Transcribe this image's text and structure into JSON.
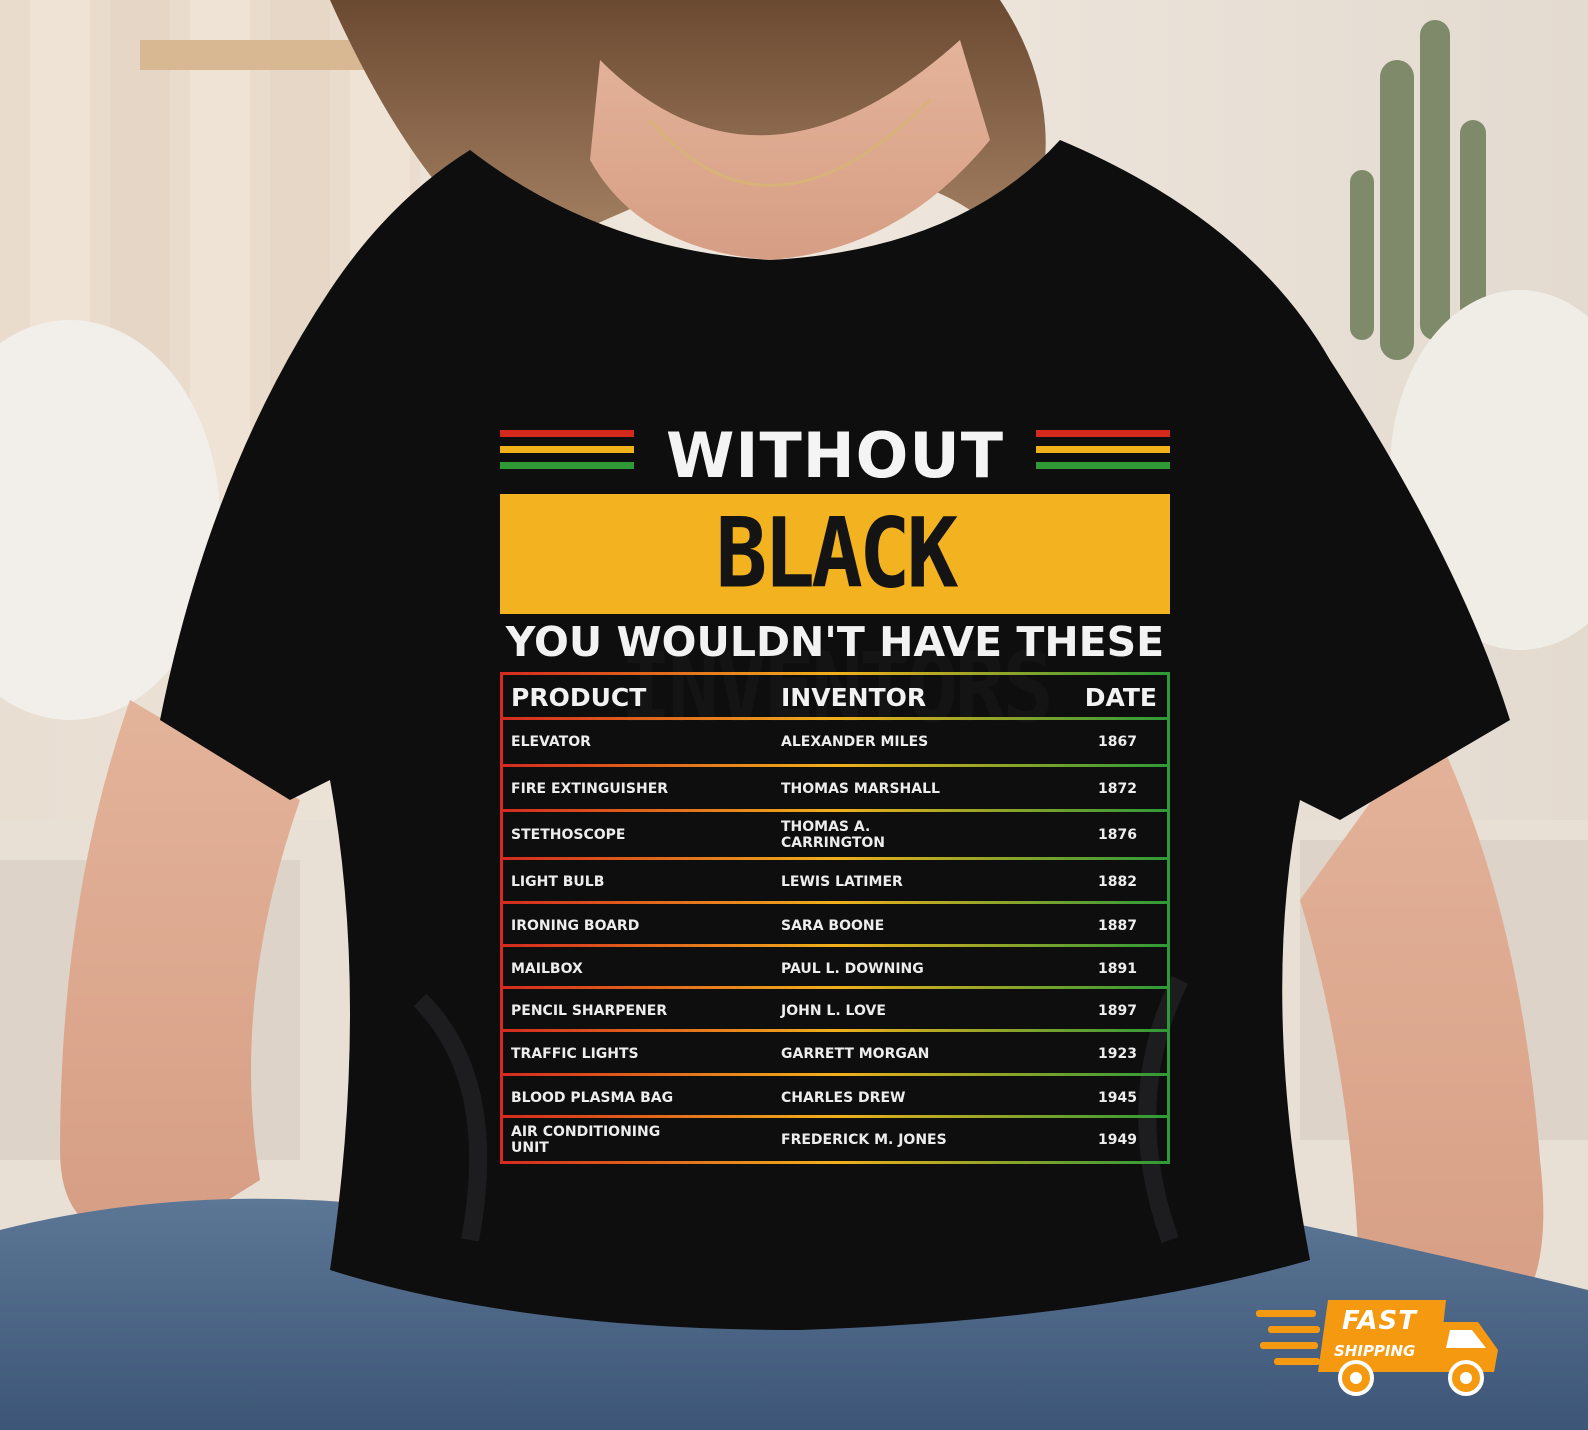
{
  "design": {
    "headline_top": "WITHOUT",
    "headline_main": "BLACK INVENTORS",
    "headline_sub": "YOU WOULDN'T HAVE THESE",
    "stripe_colors": [
      "#d42a1e",
      "#f0b11a",
      "#2f9a35"
    ],
    "band_color": "#f3b320"
  },
  "table": {
    "headers": {
      "product": "PRODUCT",
      "inventor": "INVENTOR",
      "date": "DATE"
    },
    "rows": [
      {
        "product": "ELEVATOR",
        "inventor": "ALEXANDER MILES",
        "date": "1867"
      },
      {
        "product": "FIRE EXTINGUISHER",
        "inventor": "THOMAS MARSHALL",
        "date": "1872"
      },
      {
        "product": "STETHOSCOPE",
        "inventor": "THOMAS A. CARRINGTON",
        "date": "1876"
      },
      {
        "product": "LIGHT BULB",
        "inventor": "LEWIS LATIMER",
        "date": "1882"
      },
      {
        "product": "IRONING BOARD",
        "inventor": "SARA BOONE",
        "date": "1887"
      },
      {
        "product": "MAILBOX",
        "inventor": "PAUL L. DOWNING",
        "date": "1891"
      },
      {
        "product": "PENCIL SHARPENER",
        "inventor": "JOHN L. LOVE",
        "date": "1897"
      },
      {
        "product": "TRAFFIC LIGHTS",
        "inventor": "GARRETT MORGAN",
        "date": "1923"
      },
      {
        "product": "BLOOD PLASMA BAG",
        "inventor": "CHARLES DREW",
        "date": "1945"
      },
      {
        "product": "AIR CONDITIONING UNIT",
        "inventor": "FREDERICK M. JONES",
        "date": "1949"
      }
    ]
  },
  "badge": {
    "line1": "FAST",
    "line2": "SHIPPING",
    "color": "#f59a10"
  }
}
